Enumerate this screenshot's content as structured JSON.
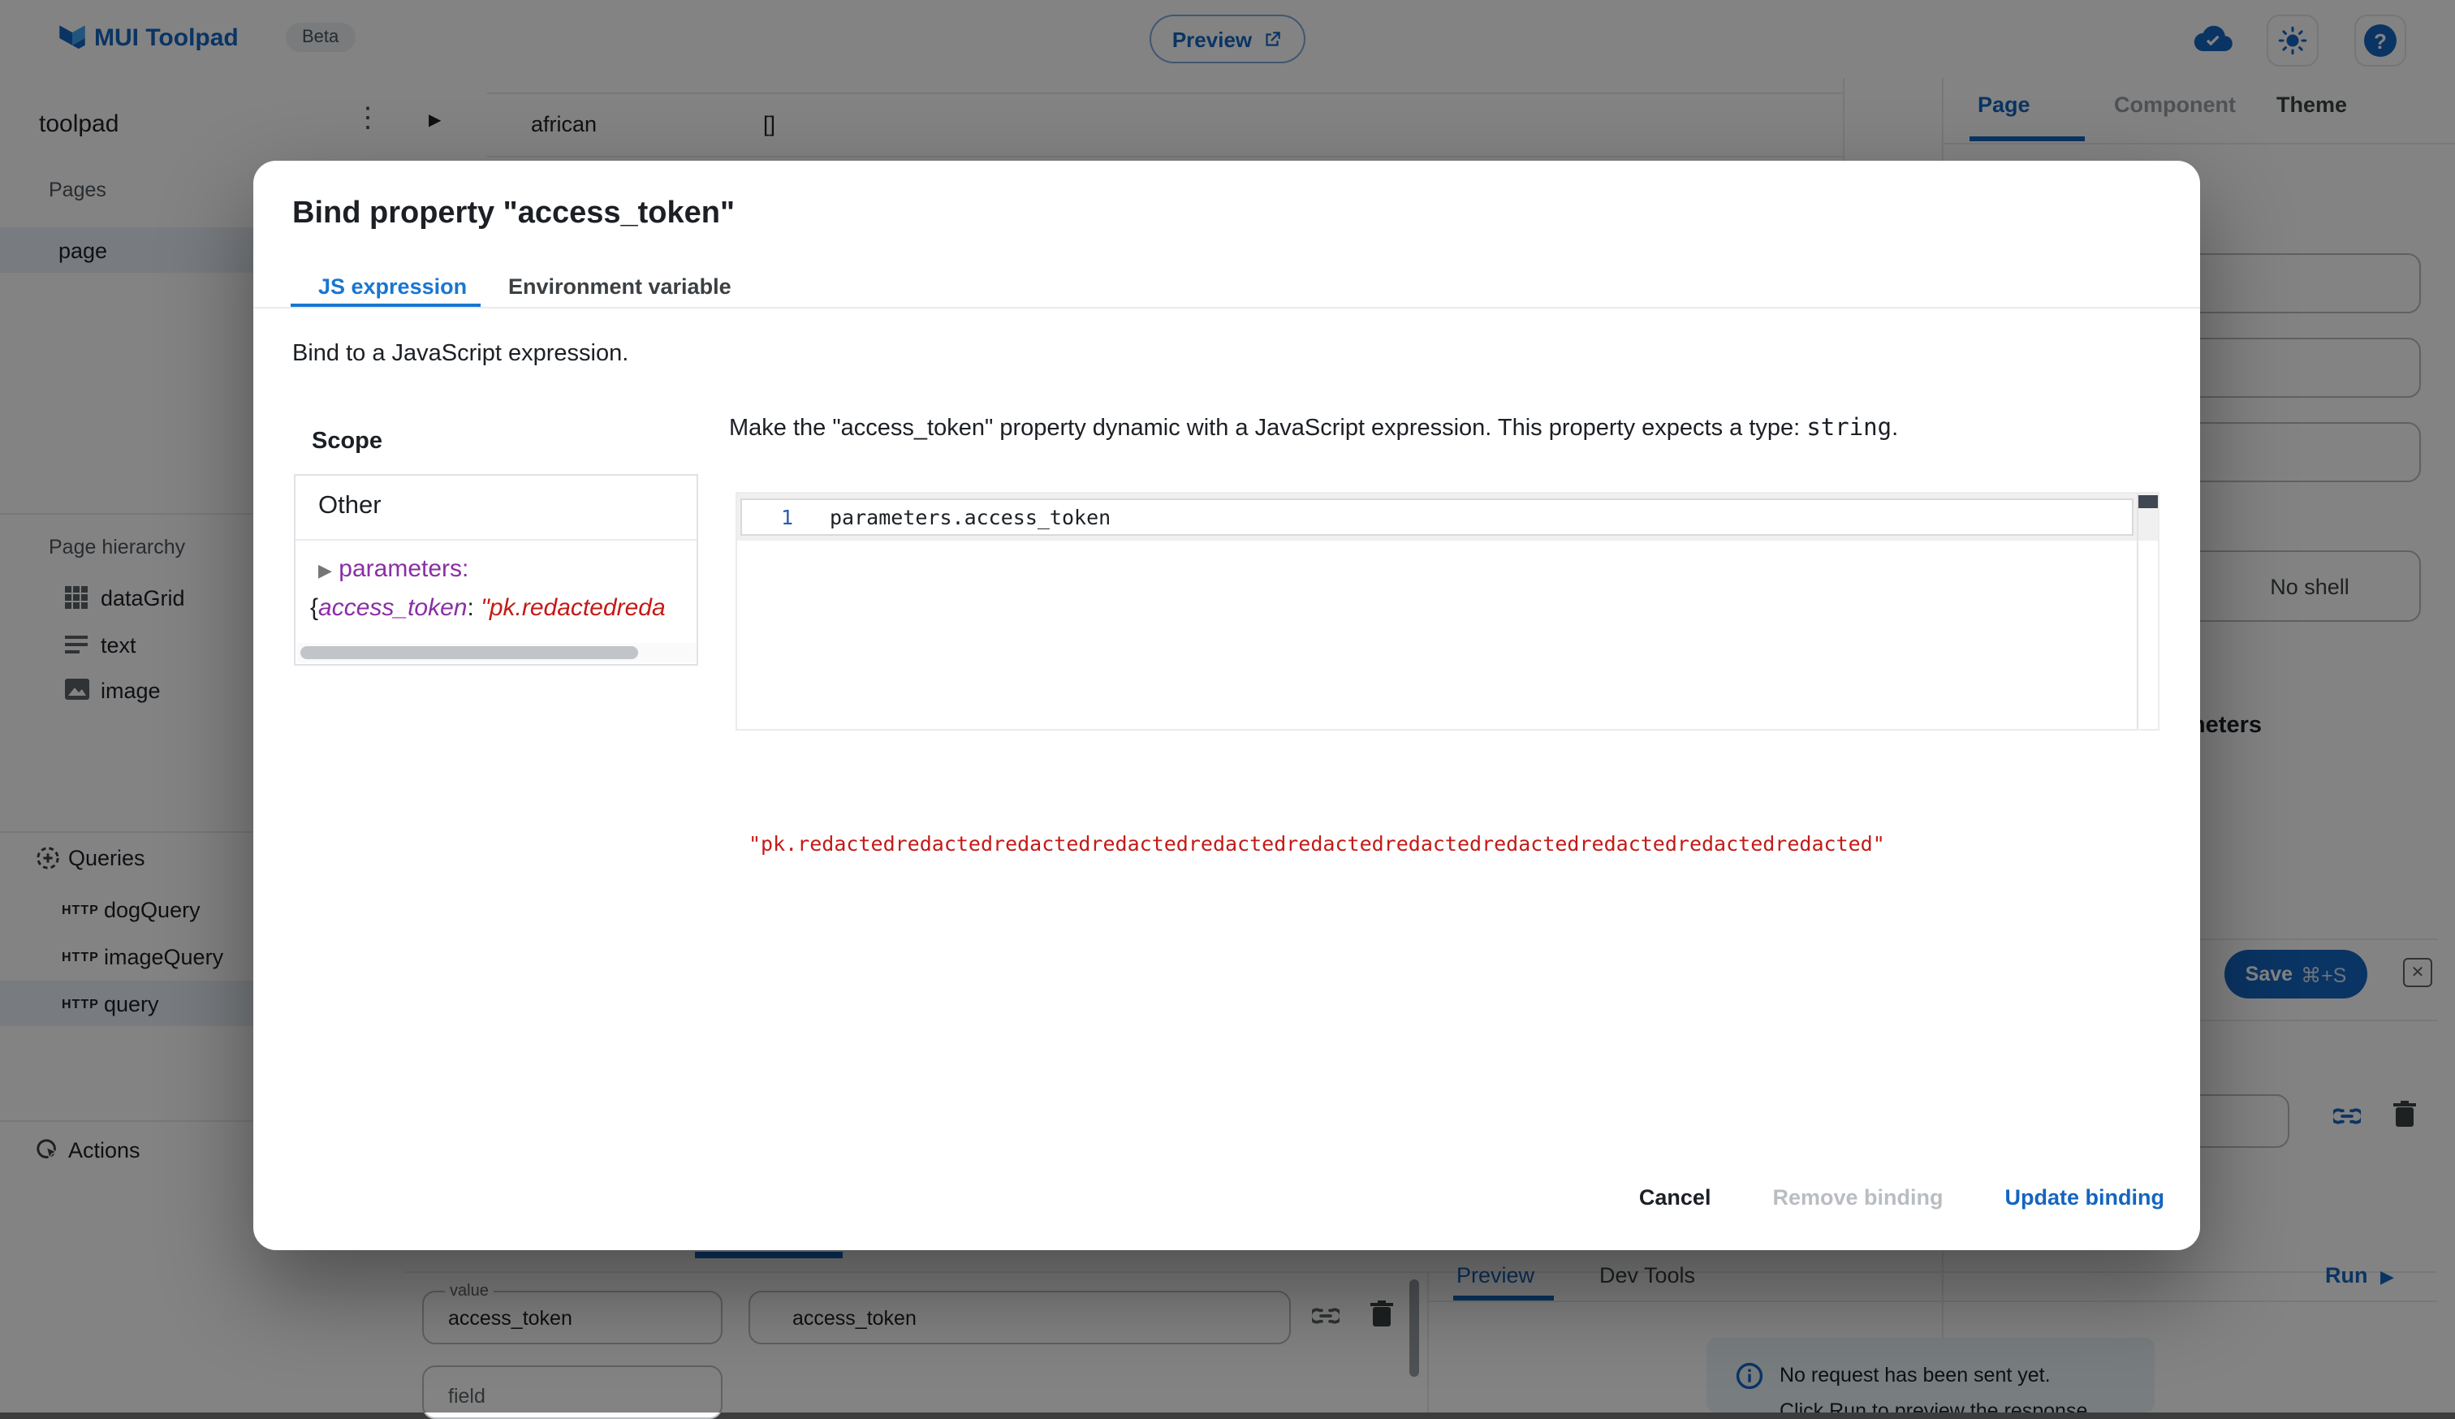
{
  "header": {
    "app_title": "MUI Toolpad",
    "beta_label": "Beta",
    "preview_button": "Preview"
  },
  "explorer": {
    "project_name": "toolpad",
    "pages_label": "Pages",
    "page_item": "page",
    "hierarchy_label": "Page hierarchy",
    "hierarchy": [
      {
        "label": "dataGrid"
      },
      {
        "label": "text"
      },
      {
        "label": "image"
      }
    ],
    "queries_label": "Queries",
    "queries": [
      {
        "method": "HTTP",
        "label": "dogQuery"
      },
      {
        "method": "HTTP",
        "label": "imageQuery"
      },
      {
        "method": "HTTP",
        "label": "query"
      }
    ],
    "actions_label": "Actions"
  },
  "canvas": {
    "row_cell": "african",
    "row_value": "[]"
  },
  "inspector": {
    "tab_page": "Page",
    "tab_component": "Component",
    "tab_theme": "Theme",
    "display_mode_selected": "No shell"
  },
  "query_editor": {
    "parameters_heading": "Parameters",
    "save_label": "Save",
    "save_shortcut": "⌘+S",
    "close_glyph": "✕",
    "param_name_label": "value",
    "param_name_value": "access_token",
    "param_value": "access_token",
    "field_placeholder": "field",
    "preview_tab": "Preview",
    "devtools_tab": "Dev Tools",
    "run_label": "Run",
    "run_glyph": "▶",
    "info_line1": "No request has been sent yet.",
    "info_line2": "Click Run to preview the response"
  },
  "dialog": {
    "title": "Bind property \"access_token\"",
    "tab_js": "JS expression",
    "tab_env": "Environment variable",
    "subtitle": "Bind to a JavaScript expression.",
    "scope": {
      "heading": "Scope",
      "group": "Other",
      "expander": "▶",
      "node_key": "parameters:",
      "preview_brace": "{",
      "preview_key": "access_token",
      "preview_colon": ": ",
      "preview_value": "\"pk.redactedreda"
    },
    "description": {
      "part1": "Make the \"access_token\" property dynamic with a JavaScript expression. This property expects a type: ",
      "type_name": "string",
      "part2": "."
    },
    "editor": {
      "line_number": "1",
      "code": "parameters.access_token"
    },
    "result": "\"pk.redactedredactedredactedredactedredactedredactedredactedredactedredactedredactedredacted\"",
    "buttons": {
      "cancel": "Cancel",
      "remove": "Remove binding",
      "update": "Update binding"
    }
  },
  "misc": {
    "kebab_glyph": "⋮",
    "expand_glyph": "▶",
    "help_glyph": "?"
  },
  "colors": {
    "accent": "#1565c0",
    "string_red": "#c41a16",
    "key_purple": "#8a2ea5"
  }
}
